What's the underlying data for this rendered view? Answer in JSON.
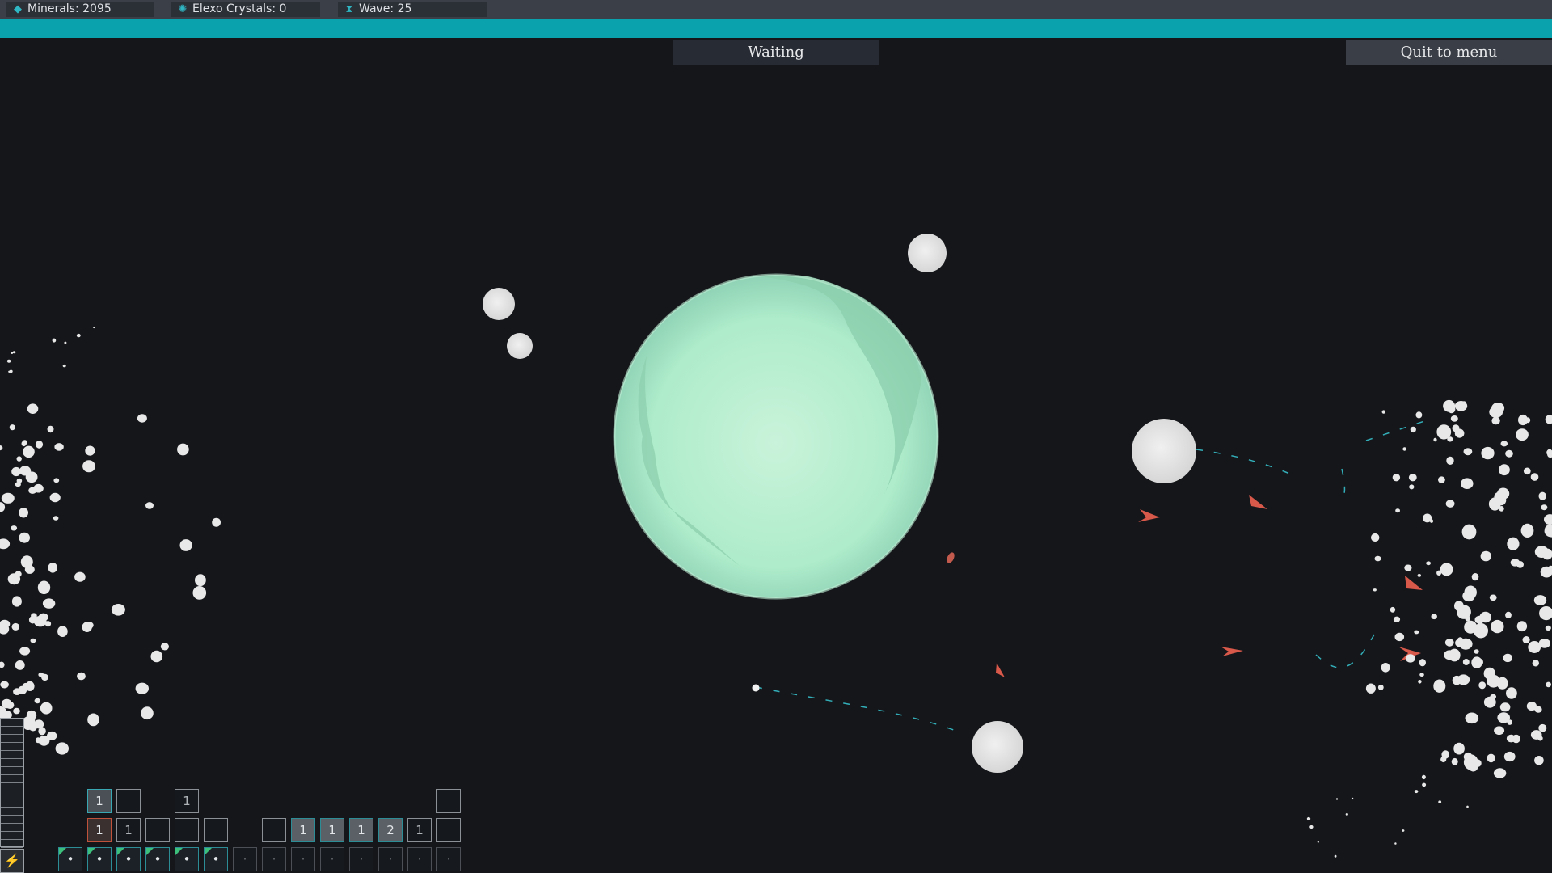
{
  "resources": {
    "minerals": "Minerals: 2095",
    "crystals": "Elexo Crystals: 0",
    "wave": "Wave: 25"
  },
  "wave_progress": 1.0,
  "status_label": "Waiting",
  "quit_label": "Quit to menu",
  "colors": {
    "accent": "#0aa3ad",
    "planet": "#a8ecc4",
    "asteroid": "#e6e6e6",
    "enemy": "#d8584a",
    "background": "#14161a"
  },
  "icons": {
    "minerals": "mineral-icon",
    "crystals": "crystal-icon",
    "wave": "hourglass-icon",
    "corner": "lightning-icon"
  },
  "toolbar": {
    "row1": [
      "1",
      "",
      "1",
      ""
    ],
    "row2_left": [
      "1",
      "1",
      "",
      "",
      ""
    ],
    "row2_right": [
      "",
      "1",
      "1",
      "1",
      "2",
      "1",
      ""
    ],
    "row3": [
      "",
      "",
      "",
      "",
      "",
      "",
      "",
      "",
      "",
      "",
      "",
      "",
      "",
      ""
    ]
  }
}
